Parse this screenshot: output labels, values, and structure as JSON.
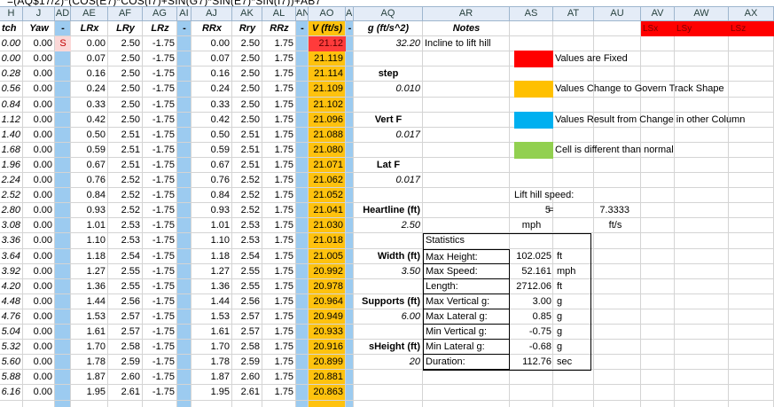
{
  "formula": "=(AQ$17/2)*(COS(E7)*COS(I7)+SIN(G7)*SIN(E7)*SIN(I7))+AB7",
  "column_headers": [
    "H",
    "J",
    "AD",
    "AE",
    "AF",
    "AG",
    "AI",
    "AJ",
    "AK",
    "AL",
    "AN",
    "AO",
    "AP",
    "AQ",
    "AR",
    "AS",
    "AT",
    "AU",
    "AV",
    "AW",
    "AX"
  ],
  "field_headers": {
    "pitch": "tch",
    "yaw": "Yaw",
    "dash1": "-",
    "lrx": "LRx",
    "lry": "LRy",
    "lrz": "LRz",
    "dash2": "-",
    "rrx": "RRx",
    "rry": "Rry",
    "rrz": "RRz",
    "dash3": "-",
    "v": "V (ft/s)",
    "dash4": "-",
    "g": "g (ft/s^2)",
    "notes": "Notes",
    "lsx": "LSx",
    "lsy": "LSy",
    "lsz": "LSz"
  },
  "rows": [
    {
      "pitch": "0.00",
      "yaw": "0.00",
      "flag": "S",
      "lrx": "0.00",
      "lry": "2.50",
      "lrz": "-1.75",
      "rrx": "0.00",
      "rry": "2.50",
      "rrz": "1.75",
      "v": "21.12"
    },
    {
      "pitch": "0.00",
      "yaw": "0.00",
      "flag": "",
      "lrx": "0.07",
      "lry": "2.50",
      "lrz": "-1.75",
      "rrx": "0.07",
      "rry": "2.50",
      "rrz": "1.75",
      "v": "21.119"
    },
    {
      "pitch": "0.28",
      "yaw": "0.00",
      "flag": "",
      "lrx": "0.16",
      "lry": "2.50",
      "lrz": "-1.75",
      "rrx": "0.16",
      "rry": "2.50",
      "rrz": "1.75",
      "v": "21.114"
    },
    {
      "pitch": "0.56",
      "yaw": "0.00",
      "flag": "",
      "lrx": "0.24",
      "lry": "2.50",
      "lrz": "-1.75",
      "rrx": "0.24",
      "rry": "2.50",
      "rrz": "1.75",
      "v": "21.109"
    },
    {
      "pitch": "0.84",
      "yaw": "0.00",
      "flag": "",
      "lrx": "0.33",
      "lry": "2.50",
      "lrz": "-1.75",
      "rrx": "0.33",
      "rry": "2.50",
      "rrz": "1.75",
      "v": "21.102"
    },
    {
      "pitch": "1.12",
      "yaw": "0.00",
      "flag": "",
      "lrx": "0.42",
      "lry": "2.50",
      "lrz": "-1.75",
      "rrx": "0.42",
      "rry": "2.50",
      "rrz": "1.75",
      "v": "21.096"
    },
    {
      "pitch": "1.40",
      "yaw": "0.00",
      "flag": "",
      "lrx": "0.50",
      "lry": "2.51",
      "lrz": "-1.75",
      "rrx": "0.50",
      "rry": "2.51",
      "rrz": "1.75",
      "v": "21.088"
    },
    {
      "pitch": "1.68",
      "yaw": "0.00",
      "flag": "",
      "lrx": "0.59",
      "lry": "2.51",
      "lrz": "-1.75",
      "rrx": "0.59",
      "rry": "2.51",
      "rrz": "1.75",
      "v": "21.080"
    },
    {
      "pitch": "1.96",
      "yaw": "0.00",
      "flag": "",
      "lrx": "0.67",
      "lry": "2.51",
      "lrz": "-1.75",
      "rrx": "0.67",
      "rry": "2.51",
      "rrz": "1.75",
      "v": "21.071"
    },
    {
      "pitch": "2.24",
      "yaw": "0.00",
      "flag": "",
      "lrx": "0.76",
      "lry": "2.52",
      "lrz": "-1.75",
      "rrx": "0.76",
      "rry": "2.52",
      "rrz": "1.75",
      "v": "21.062"
    },
    {
      "pitch": "2.52",
      "yaw": "0.00",
      "flag": "",
      "lrx": "0.84",
      "lry": "2.52",
      "lrz": "-1.75",
      "rrx": "0.84",
      "rry": "2.52",
      "rrz": "1.75",
      "v": "21.052"
    },
    {
      "pitch": "2.80",
      "yaw": "0.00",
      "flag": "",
      "lrx": "0.93",
      "lry": "2.52",
      "lrz": "-1.75",
      "rrx": "0.93",
      "rry": "2.52",
      "rrz": "1.75",
      "v": "21.041"
    },
    {
      "pitch": "3.08",
      "yaw": "0.00",
      "flag": "",
      "lrx": "1.01",
      "lry": "2.53",
      "lrz": "-1.75",
      "rrx": "1.01",
      "rry": "2.53",
      "rrz": "1.75",
      "v": "21.030"
    },
    {
      "pitch": "3.36",
      "yaw": "0.00",
      "flag": "",
      "lrx": "1.10",
      "lry": "2.53",
      "lrz": "-1.75",
      "rrx": "1.10",
      "rry": "2.53",
      "rrz": "1.75",
      "v": "21.018"
    },
    {
      "pitch": "3.64",
      "yaw": "0.00",
      "flag": "",
      "lrx": "1.18",
      "lry": "2.54",
      "lrz": "-1.75",
      "rrx": "1.18",
      "rry": "2.54",
      "rrz": "1.75",
      "v": "21.005"
    },
    {
      "pitch": "3.92",
      "yaw": "0.00",
      "flag": "",
      "lrx": "1.27",
      "lry": "2.55",
      "lrz": "-1.75",
      "rrx": "1.27",
      "rry": "2.55",
      "rrz": "1.75",
      "v": "20.992"
    },
    {
      "pitch": "4.20",
      "yaw": "0.00",
      "flag": "",
      "lrx": "1.36",
      "lry": "2.55",
      "lrz": "-1.75",
      "rrx": "1.36",
      "rry": "2.55",
      "rrz": "1.75",
      "v": "20.978"
    },
    {
      "pitch": "4.48",
      "yaw": "0.00",
      "flag": "",
      "lrx": "1.44",
      "lry": "2.56",
      "lrz": "-1.75",
      "rrx": "1.44",
      "rry": "2.56",
      "rrz": "1.75",
      "v": "20.964"
    },
    {
      "pitch": "4.76",
      "yaw": "0.00",
      "flag": "",
      "lrx": "1.53",
      "lry": "2.57",
      "lrz": "-1.75",
      "rrx": "1.53",
      "rry": "2.57",
      "rrz": "1.75",
      "v": "20.949"
    },
    {
      "pitch": "5.04",
      "yaw": "0.00",
      "flag": "",
      "lrx": "1.61",
      "lry": "2.57",
      "lrz": "-1.75",
      "rrx": "1.61",
      "rry": "2.57",
      "rrz": "1.75",
      "v": "20.933"
    },
    {
      "pitch": "5.32",
      "yaw": "0.00",
      "flag": "",
      "lrx": "1.70",
      "lry": "2.58",
      "lrz": "-1.75",
      "rrx": "1.70",
      "rry": "2.58",
      "rrz": "1.75",
      "v": "20.916"
    },
    {
      "pitch": "5.60",
      "yaw": "0.00",
      "flag": "",
      "lrx": "1.78",
      "lry": "2.59",
      "lrz": "-1.75",
      "rrx": "1.78",
      "rry": "2.59",
      "rrz": "1.75",
      "v": "20.899"
    },
    {
      "pitch": "5.88",
      "yaw": "0.00",
      "flag": "",
      "lrx": "1.87",
      "lry": "2.60",
      "lrz": "-1.75",
      "rrx": "1.87",
      "rry": "2.60",
      "rrz": "1.75",
      "v": "20.881"
    },
    {
      "pitch": "6.16",
      "yaw": "0.00",
      "flag": "",
      "lrx": "1.95",
      "lry": "2.61",
      "lrz": "-1.75",
      "rrx": "1.95",
      "rry": "2.61",
      "rrz": "1.75",
      "v": "20.863"
    }
  ],
  "params": {
    "g_value": "32.20",
    "g_note": "Incline to lift hill",
    "step_label": "step",
    "step_value": "0.010",
    "vertf_label": "Vert F",
    "vertf_value": "0.017",
    "latf_label": "Lat F",
    "latf_value": "0.017",
    "heartline_label": "Heartline (ft)",
    "heartline_value": "2.50",
    "width_label": "Width (ft)",
    "width_value": "3.50",
    "supports_label": "Supports (ft)",
    "supports_value": "6.00",
    "sheight_label": "sHeight (ft)",
    "sheight_value": "20"
  },
  "legend": [
    {
      "color": "#ff0000",
      "text": "Values are Fixed"
    },
    {
      "color": "#ffc000",
      "text": "Values Change to Govern Track Shape"
    },
    {
      "color": "#00b0f0",
      "text": "Values Result from Change in other Column"
    },
    {
      "color": "#92d050",
      "text": "Cell is different than normal"
    }
  ],
  "lift": {
    "title": "Lift hill speed:",
    "mph_value": "5",
    "eq": "=",
    "fts_value": "7.3333",
    "mph_unit": "mph",
    "fts_unit": "ft/s"
  },
  "stats": {
    "title": "Statistics",
    "items": [
      {
        "label": "Max Height:",
        "value": "102.025",
        "unit": "ft"
      },
      {
        "label": "Max Speed:",
        "value": "52.161",
        "unit": "mph"
      },
      {
        "label": "Length:",
        "value": "2712.06",
        "unit": "ft"
      },
      {
        "label": "Max Vertical g:",
        "value": "3.00",
        "unit": "g"
      },
      {
        "label": "Max Lateral g:",
        "value": "0.85",
        "unit": "g"
      },
      {
        "label": "Min Vertical g:",
        "value": "-0.75",
        "unit": "g"
      },
      {
        "label": "Min Lateral g:",
        "value": "-0.68",
        "unit": "g"
      },
      {
        "label": "Duration:",
        "value": "112.76",
        "unit": "sec"
      }
    ]
  },
  "colors": {
    "blue_column": "#9ccbf0",
    "orange_column": "#ffc20e",
    "fixed_red": "#ff0000",
    "header_bg": "#e4ecf7"
  }
}
